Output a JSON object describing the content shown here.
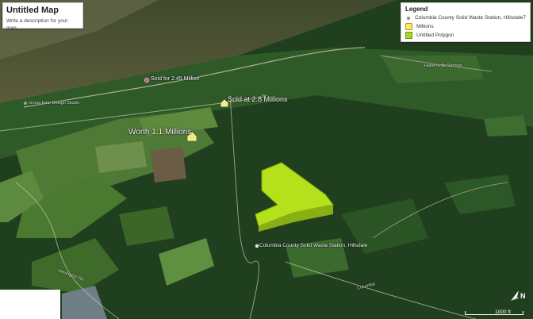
{
  "map": {
    "title": "Untitled Map",
    "description": "Write a description for your map.",
    "legend": {
      "title": "Legend",
      "items": [
        {
          "label": "Columbia County Solid Waste Station, Hillsdale7",
          "icon": "pin-dot-icon"
        },
        {
          "label": "Millions",
          "icon": "house-icon"
        },
        {
          "label": "Untitled Polygon",
          "icon": "polygon-icon"
        }
      ]
    },
    "places": {
      "sold_245": "Sold for 2.45 Million",
      "sold_28": "Sold at 2.8 Millions",
      "worth_11": "Worth 1.1 Millions",
      "waste_station": "Columbia County Solid Waste Station, Hillsdale",
      "design_studio": "Group Four Design Studio",
      "herrington_rd": "Herrington Rd",
      "columbia": "Columbia",
      "springs": "Harlemville Springs",
      "hollow": "Hollow Rd",
      "rt": "Rt 23"
    },
    "scale_label": "1000 ft",
    "colors": {
      "polygon_fill": "#b4e01c",
      "polygon_edge": "#7ea80f"
    }
  }
}
